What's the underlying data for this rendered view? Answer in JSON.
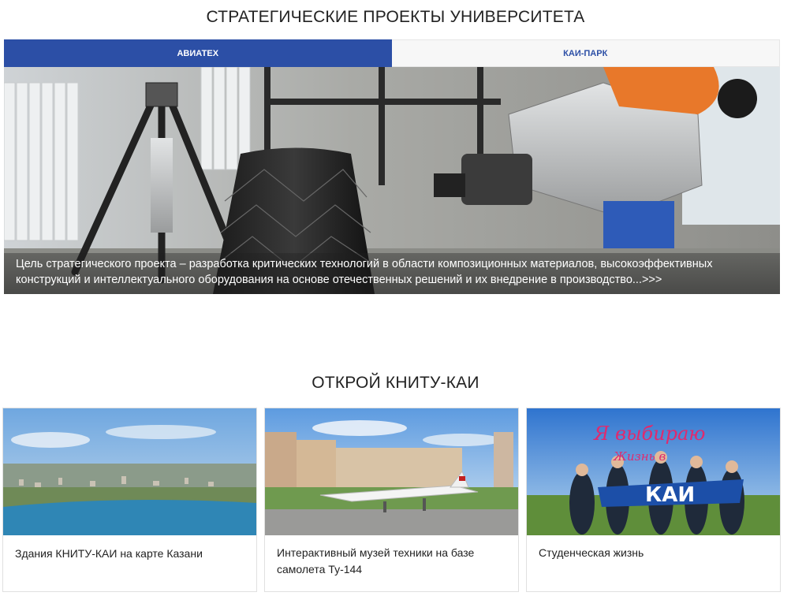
{
  "strategic": {
    "title": "СТРАТЕГИЧЕСКИЕ ПРОЕКТЫ УНИВЕРСИТЕТА",
    "tabs": [
      {
        "label": "АВИАТЕХ",
        "active": true
      },
      {
        "label": "КАИ-ПАРК",
        "active": false
      }
    ],
    "banner_caption": "Цель стратегического проекта – разработка критических технологий в области композиционных материалов, высокоэффективных конструкций и интеллектуального оборудования на основе отечественных решений и их внедрение в производство...>>>"
  },
  "discover": {
    "title": "ОТКРОЙ КНИТУ-КАИ",
    "cards": [
      {
        "label": "Здания КНИТУ-КАИ на карте Казани"
      },
      {
        "label": "Интерактивный музей техники на базе самолета Ту-144"
      },
      {
        "label": "Студенческая жизнь",
        "image_text": "Я выбираю",
        "image_text2": "Жизнь в",
        "image_logo": "КАИ"
      }
    ]
  },
  "colors": {
    "accent": "#2c4fa6",
    "robot_orange": "#e8782a"
  }
}
